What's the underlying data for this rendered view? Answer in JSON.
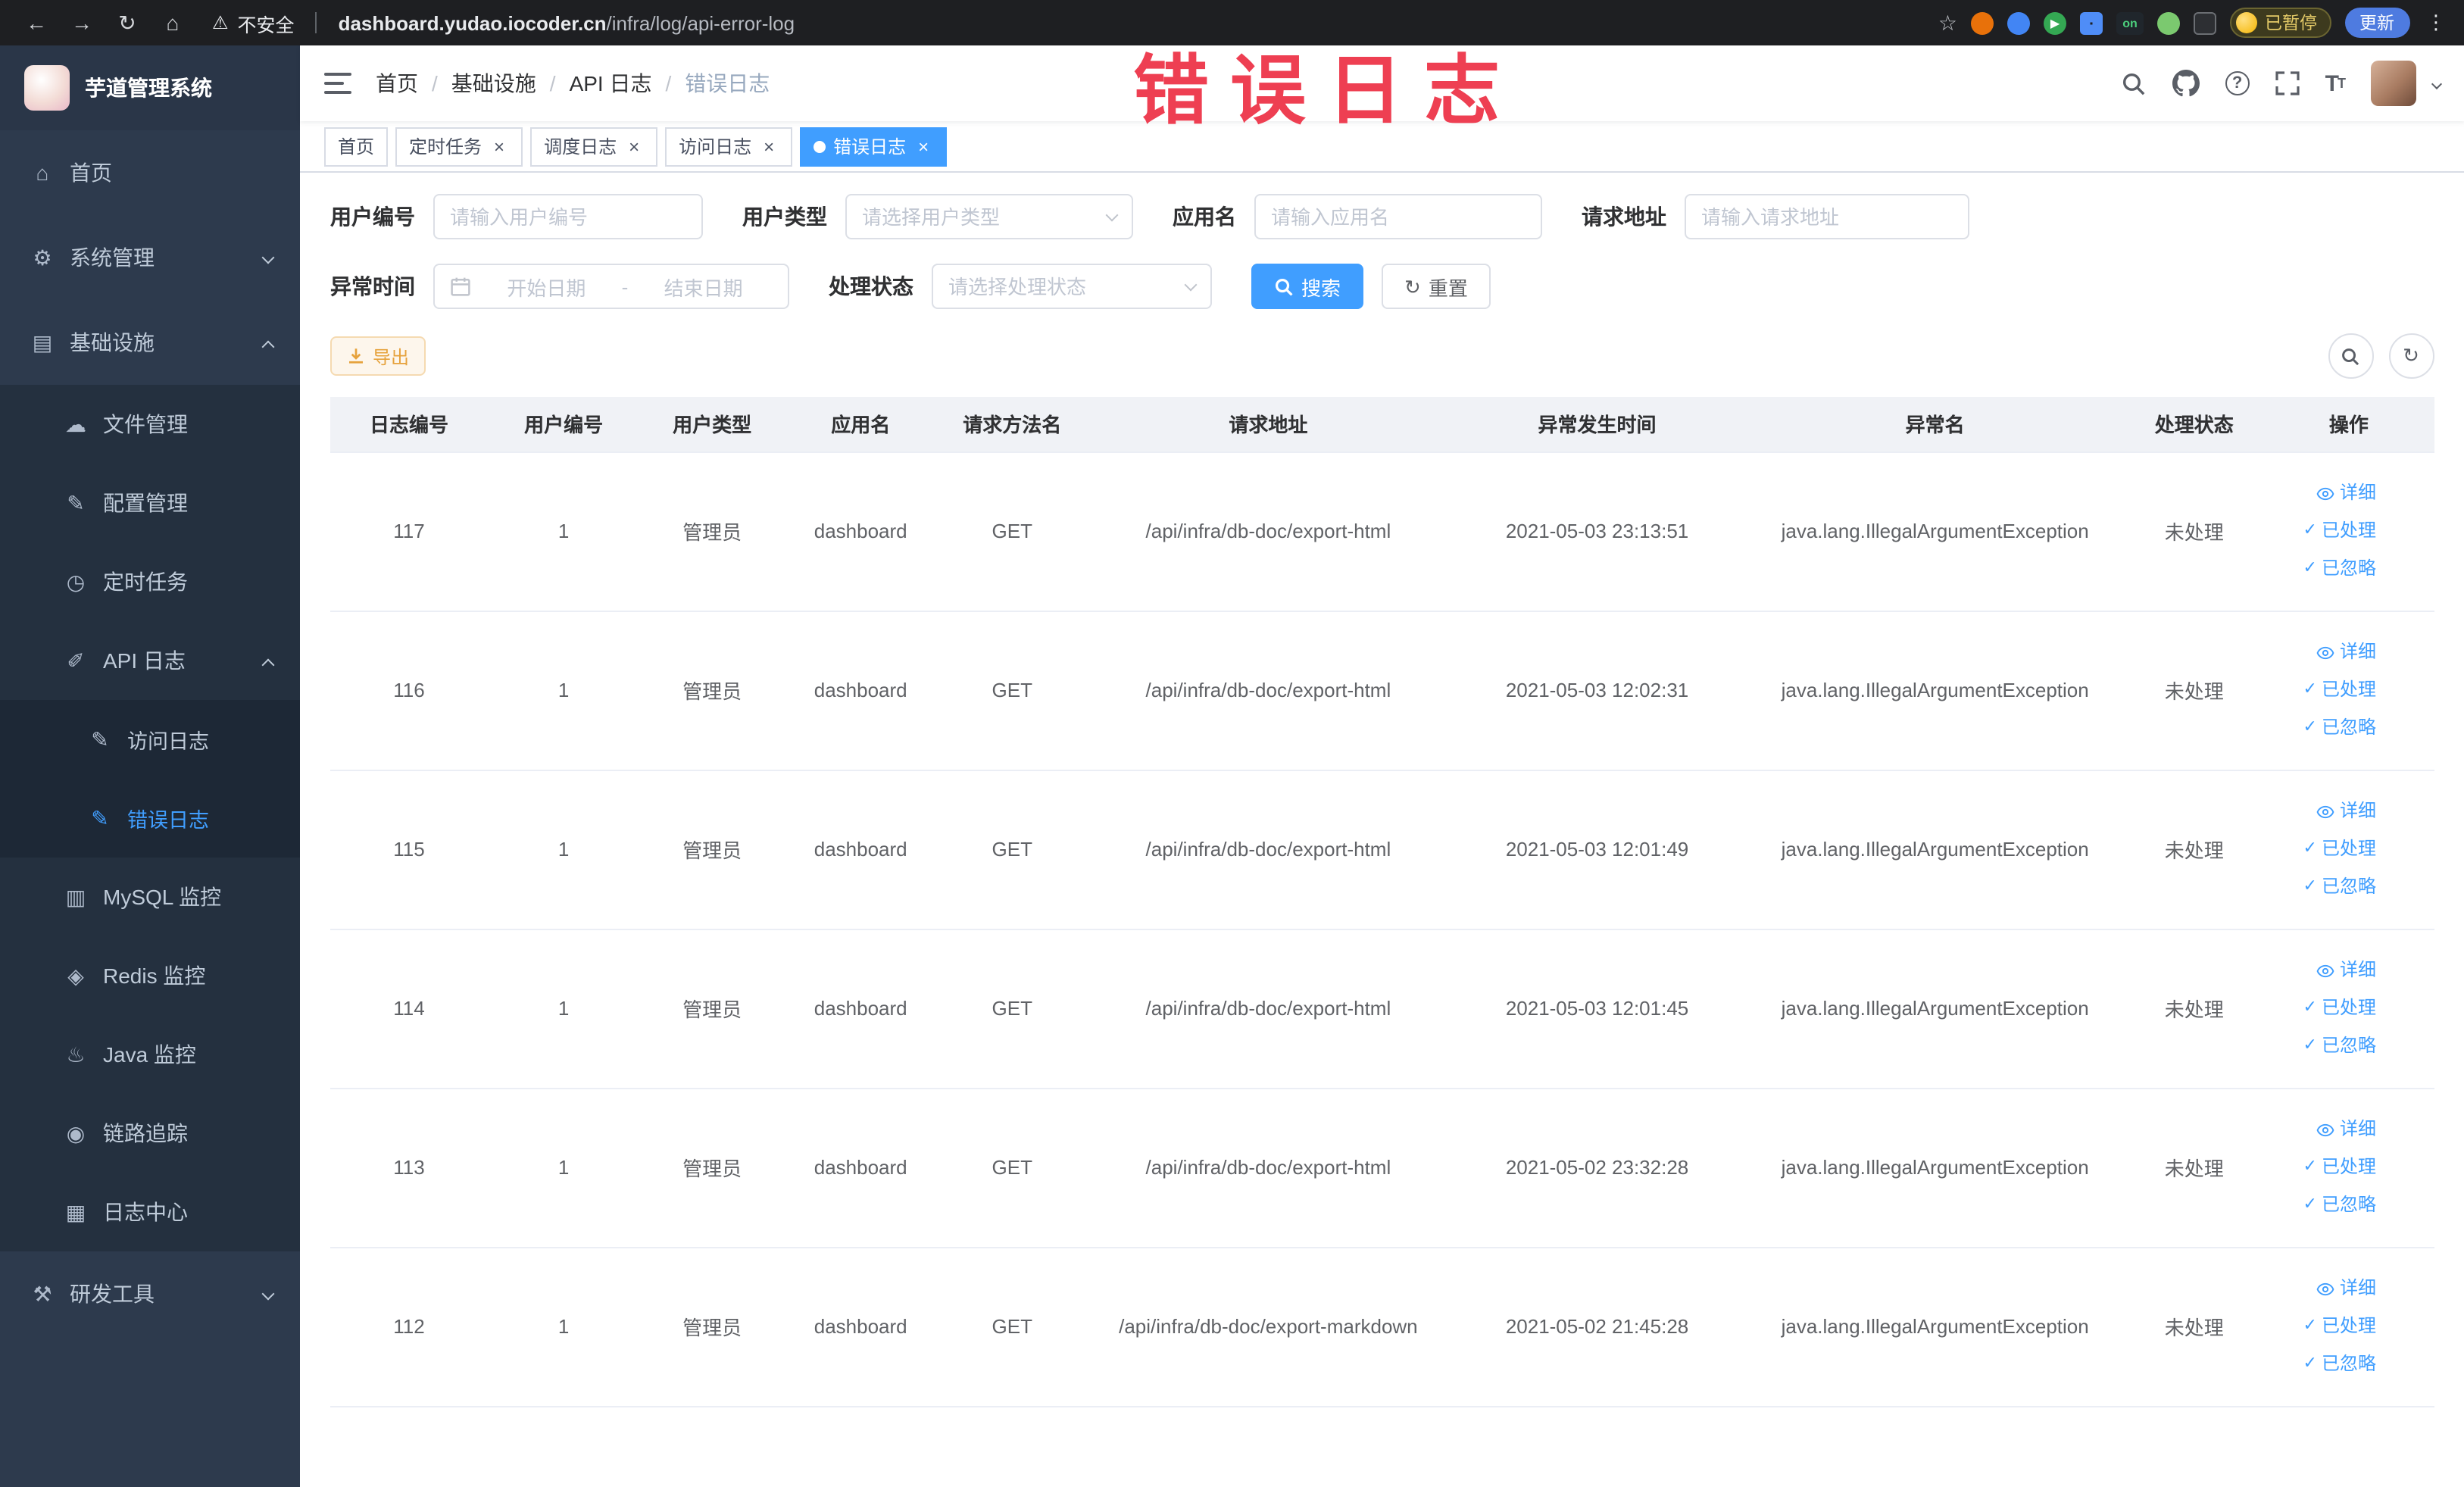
{
  "browser": {
    "security_label": "不安全",
    "url": {
      "domain": "dashboard.yudao.iocoder.cn",
      "path": "/infra/log/api-error-log"
    },
    "extension_on_label": "on",
    "paused_label": "已暂停",
    "update_label": "更新"
  },
  "overlay": {
    "text": "错误日志",
    "color": "#ee3f52"
  },
  "accent_colors": {
    "primary": "#409eff",
    "warning": "#e6a23c",
    "overlay_red": "#ee3f52"
  },
  "sidebar": {
    "title": "芋道管理系统",
    "menu": [
      {
        "key": "home",
        "label": "首页",
        "icon": "home",
        "level": 0
      },
      {
        "key": "system",
        "label": "系统管理",
        "icon": "gear",
        "level": 0,
        "arrow": "down"
      },
      {
        "key": "infra",
        "label": "基础设施",
        "icon": "infra",
        "level": 0,
        "arrow": "up"
      },
      {
        "key": "file",
        "label": "文件管理",
        "icon": "file",
        "level": 1
      },
      {
        "key": "config",
        "label": "配置管理",
        "icon": "config",
        "level": 1
      },
      {
        "key": "job",
        "label": "定时任务",
        "icon": "clock",
        "level": 1
      },
      {
        "key": "api-log",
        "label": "API 日志",
        "icon": "log",
        "level": 1,
        "arrow": "up"
      },
      {
        "key": "access-log",
        "label": "访问日志",
        "icon": "doc",
        "level": 2
      },
      {
        "key": "error-log",
        "label": "错误日志",
        "icon": "doc",
        "level": 2,
        "active": true
      },
      {
        "key": "mysql",
        "label": "MySQL 监控",
        "icon": "db",
        "level": 1
      },
      {
        "key": "redis",
        "label": "Redis 监控",
        "icon": "redis",
        "level": 1
      },
      {
        "key": "java",
        "label": "Java 监控",
        "icon": "java",
        "level": 1
      },
      {
        "key": "trace",
        "label": "链路追踪",
        "icon": "trace",
        "level": 1
      },
      {
        "key": "log-center",
        "label": "日志中心",
        "icon": "logcenter",
        "level": 1
      },
      {
        "key": "dev-tools",
        "label": "研发工具",
        "icon": "tools",
        "level": 0,
        "arrow": "down"
      }
    ]
  },
  "header": {
    "breadcrumb": [
      "首页",
      "基础设施",
      "API 日志",
      "错误日志"
    ]
  },
  "tabs": [
    {
      "label": "首页",
      "closable": false,
      "active": false
    },
    {
      "label": "定时任务",
      "closable": true,
      "active": false
    },
    {
      "label": "调度日志",
      "closable": true,
      "active": false
    },
    {
      "label": "访问日志",
      "closable": true,
      "active": false
    },
    {
      "label": "错误日志",
      "closable": true,
      "active": true
    }
  ],
  "filters": {
    "user_id": {
      "label": "用户编号",
      "placeholder": "请输入用户编号"
    },
    "user_type": {
      "label": "用户类型",
      "placeholder": "请选择用户类型"
    },
    "app_name": {
      "label": "应用名",
      "placeholder": "请输入应用名"
    },
    "request_url": {
      "label": "请求地址",
      "placeholder": "请输入请求地址"
    },
    "exception_time": {
      "label": "异常时间",
      "start_placeholder": "开始日期",
      "separator": "-",
      "end_placeholder": "结束日期"
    },
    "process_status": {
      "label": "处理状态",
      "placeholder": "请选择处理状态"
    },
    "search_label": "搜索",
    "reset_label": "重置"
  },
  "toolbar": {
    "export_label": "导出"
  },
  "table": {
    "columns": [
      "日志编号",
      "用户编号",
      "用户类型",
      "应用名",
      "请求方法名",
      "请求地址",
      "异常发生时间",
      "异常名",
      "处理状态",
      "操作"
    ],
    "actions": [
      {
        "label": "详细",
        "icon": "eye"
      },
      {
        "label": "已处理",
        "icon": "check"
      },
      {
        "label": "已忽略",
        "icon": "check"
      }
    ],
    "rows": [
      {
        "id": "117",
        "user_id": "1",
        "user_type": "管理员",
        "app": "dashboard",
        "method": "GET",
        "url": "/api/infra/db-doc/export-html",
        "time": "2021-05-03 23:13:51",
        "exception": "java.lang.IllegalArgumentException",
        "status": "未处理"
      },
      {
        "id": "116",
        "user_id": "1",
        "user_type": "管理员",
        "app": "dashboard",
        "method": "GET",
        "url": "/api/infra/db-doc/export-html",
        "time": "2021-05-03 12:02:31",
        "exception": "java.lang.IllegalArgumentException",
        "status": "未处理"
      },
      {
        "id": "115",
        "user_id": "1",
        "user_type": "管理员",
        "app": "dashboard",
        "method": "GET",
        "url": "/api/infra/db-doc/export-html",
        "time": "2021-05-03 12:01:49",
        "exception": "java.lang.IllegalArgumentException",
        "status": "未处理"
      },
      {
        "id": "114",
        "user_id": "1",
        "user_type": "管理员",
        "app": "dashboard",
        "method": "GET",
        "url": "/api/infra/db-doc/export-html",
        "time": "2021-05-03 12:01:45",
        "exception": "java.lang.IllegalArgumentException",
        "status": "未处理"
      },
      {
        "id": "113",
        "user_id": "1",
        "user_type": "管理员",
        "app": "dashboard",
        "method": "GET",
        "url": "/api/infra/db-doc/export-html",
        "time": "2021-05-02 23:32:28",
        "exception": "java.lang.IllegalArgumentException",
        "status": "未处理"
      },
      {
        "id": "112",
        "user_id": "1",
        "user_type": "管理员",
        "app": "dashboard",
        "method": "GET",
        "url": "/api/infra/db-doc/export-markdown",
        "time": "2021-05-02 21:45:28",
        "exception": "java.lang.IllegalArgumentException",
        "status": "未处理"
      }
    ]
  }
}
